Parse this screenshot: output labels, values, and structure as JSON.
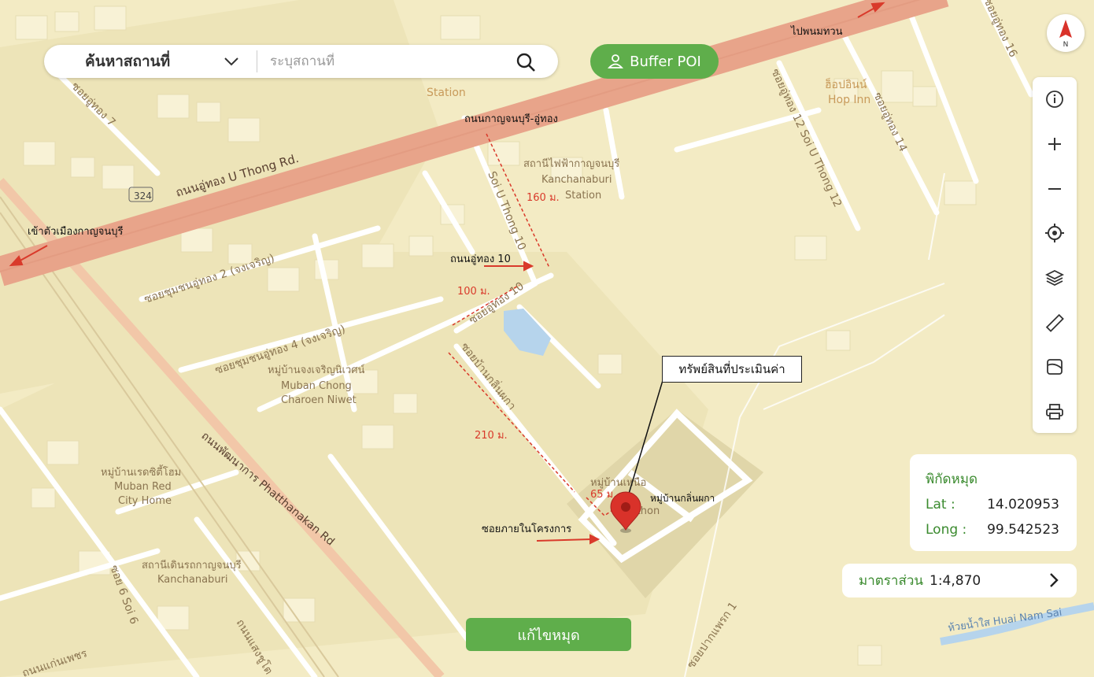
{
  "search": {
    "type_label": "ค้นหาสถานที่",
    "placeholder": "ระบุสถานที่"
  },
  "buffer_button": {
    "label": "Buffer POI"
  },
  "compass": {
    "label": "N"
  },
  "toolbar": {
    "tools": [
      "info-icon",
      "zoom-in-icon",
      "zoom-out-icon",
      "locate-icon",
      "layers-icon",
      "ruler-icon",
      "map-style-icon",
      "print-icon"
    ]
  },
  "coordinates": {
    "title": "พิกัดหมุด",
    "lat_label": "Lat :",
    "lat_value": "14.020953",
    "long_label": "Long :",
    "long_value": "99.542523"
  },
  "scale": {
    "label": "มาตราส่วน",
    "value": "1:4,870"
  },
  "edit_button": {
    "label": "แก้ไขหมุด"
  },
  "annotations": {
    "asset": "ทรัพย์สินที่ประเมินค่า",
    "road_kanchanaburi_uthong": "ถนนกาญจนบุรี-อู่ทอง",
    "road_uthong10": "ถนนอู่ทอง 10",
    "to_city": "เข้าตัวเมืองกาญจนบุรี",
    "to_phanom_thuan": "ไปพนมทวน",
    "project_soi": "ซอยภายในโครงการ",
    "village": "หมู่บ้านกลิ่นผกา",
    "dist_160": "160 ม.",
    "dist_100": "100 ม.",
    "dist_210": "210 ม.",
    "dist_65": "65 ม."
  },
  "map_labels": {
    "u_thong_rd": "ถนนอู่ทอง U Thong Rd.",
    "route_324": "324",
    "soi_uthong7": "ซอยอู่ทอง 7",
    "soi_chumchon2": "ซอยชุมชนอู่ทอง 2 (จงเจริญ)",
    "soi_chumchon4": "ซอยชุมชนอู่ทอง 4 (จงเจริญ)",
    "soi_uthong10": "ซอยอู่ทอง 10",
    "soi_klinphaka": "ซอยบ้านกลิ่นผกา",
    "soi_uthong12": "ซอยอู่ทอง 12 Soi U Thong 12",
    "soi_uthong14": "ซอยอู่ทอง 14",
    "soi_uthong16": "ซอยอู่ทอง 16",
    "soi_uthong_v": "Soi U Thong 10",
    "station_th": "สถานีไฟฟ้ากาญจนบุรี",
    "station_en1": "Kanchanaburi",
    "station_en2": "Station",
    "hop_inn_th": "ฮ็อปอินน์",
    "hop_inn_en": "Hop Inn",
    "service_station": "Station",
    "muban_chong_th": "หมู่บ้านจงเจริญนิเวศน์",
    "muban_chong_en1": "Muban Chong",
    "muban_chong_en2": "Charoen Niwet",
    "muban_red_th": "หมู่บ้านเรดซิตี้โฮม",
    "muban_red_en1": "Muban Red",
    "muban_red_en2": "City Home",
    "phatthanakan_rd": "ถนนพัฒนาการ Phatthanakan Rd",
    "rail_station_th": "สถานีเดินรถกาญจนบุรี",
    "rail_station_en": "Kanchanaburi",
    "village_th_label": "หมู่บ้านเหนือ",
    "village_en_label": "Athon",
    "huai_nam_sai": "ห้วยน้ำใส Huai Nam Sai",
    "soi_pakphraek": "ซอยปากแพรก 1",
    "soi6": "ซอย 6 Soi 6",
    "road_saeng": "ถนนแสงชูโต",
    "road_low": "ถนนแก่นเพชร"
  },
  "colors": {
    "map_bg": "#f3ebc4",
    "highway": "#e8a48a",
    "accent_green": "#5fae4b",
    "annotation_red": "#d93a2b",
    "pin": "#d9322a"
  }
}
